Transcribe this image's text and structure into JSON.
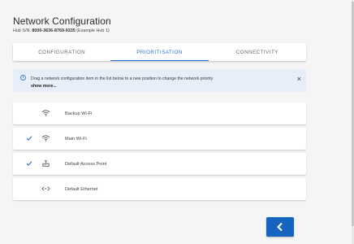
{
  "page": {
    "title": "Network Configuration",
    "hub_label": "Hub S/N:",
    "hub_serial": "8000-3636-8769-9335",
    "hub_name": "(Example Hub 1)"
  },
  "tabs": [
    {
      "label": "CONFIGURATION",
      "active": false
    },
    {
      "label": "PRIORITISATION",
      "active": true
    },
    {
      "label": "CONNECTIVITY",
      "active": false
    }
  ],
  "alert": {
    "message": "Drag a network configuration item in the list below to a new position to change the network priority",
    "more": "show more...",
    "icon": "info-icon",
    "close_icon": "close-icon"
  },
  "networks": [
    {
      "label": "Backup Wi-Fi",
      "icon": "wifi-icon",
      "checked": false
    },
    {
      "label": "Main Wi-Fi",
      "icon": "wifi-icon",
      "checked": true
    },
    {
      "label": "Default Access Point",
      "icon": "router-icon",
      "checked": true
    },
    {
      "label": "Default Ethernet",
      "icon": "ethernet-icon",
      "checked": false
    }
  ],
  "back_button": {
    "icon": "chevron-left-icon"
  },
  "colors": {
    "accent": "#2a6fd6",
    "button": "#1565c0",
    "alert_bg": "#e6eefa"
  }
}
